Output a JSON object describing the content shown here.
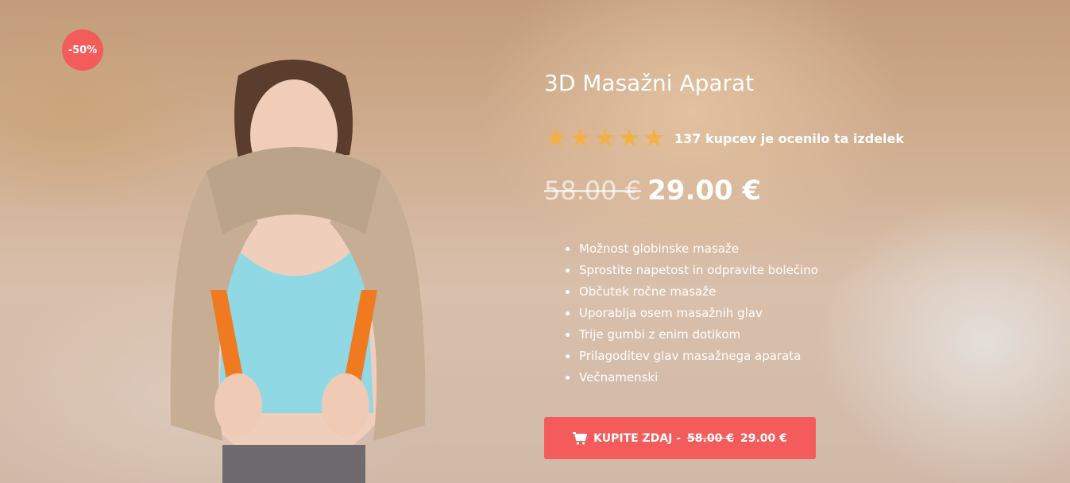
{
  "badge": {
    "discount": "-50%"
  },
  "product": {
    "title": "3D Masažni Aparat",
    "rating": {
      "stars": 5,
      "text": "137 kupcev je ocenilo ta izdelek"
    },
    "old_price": "58.00 €",
    "new_price": "29.00 €",
    "features": [
      "Možnost globinske masaže",
      "Sprostite napetost in odpravite bolečino",
      "Občutek ročne masaže",
      "Uporablja osem masažnih glav",
      "Trije gumbi z enim dotikom",
      "Prilagoditev glav masažnega aparata",
      "Večnamenski"
    ]
  },
  "buy_button": {
    "label": "KUPITE ZDAJ -",
    "old_price": "58.00 €",
    "new_price": "29.00 €",
    "icon": "cart-icon"
  },
  "colors": {
    "accent": "#f45b5b",
    "star": "#f4b042"
  }
}
